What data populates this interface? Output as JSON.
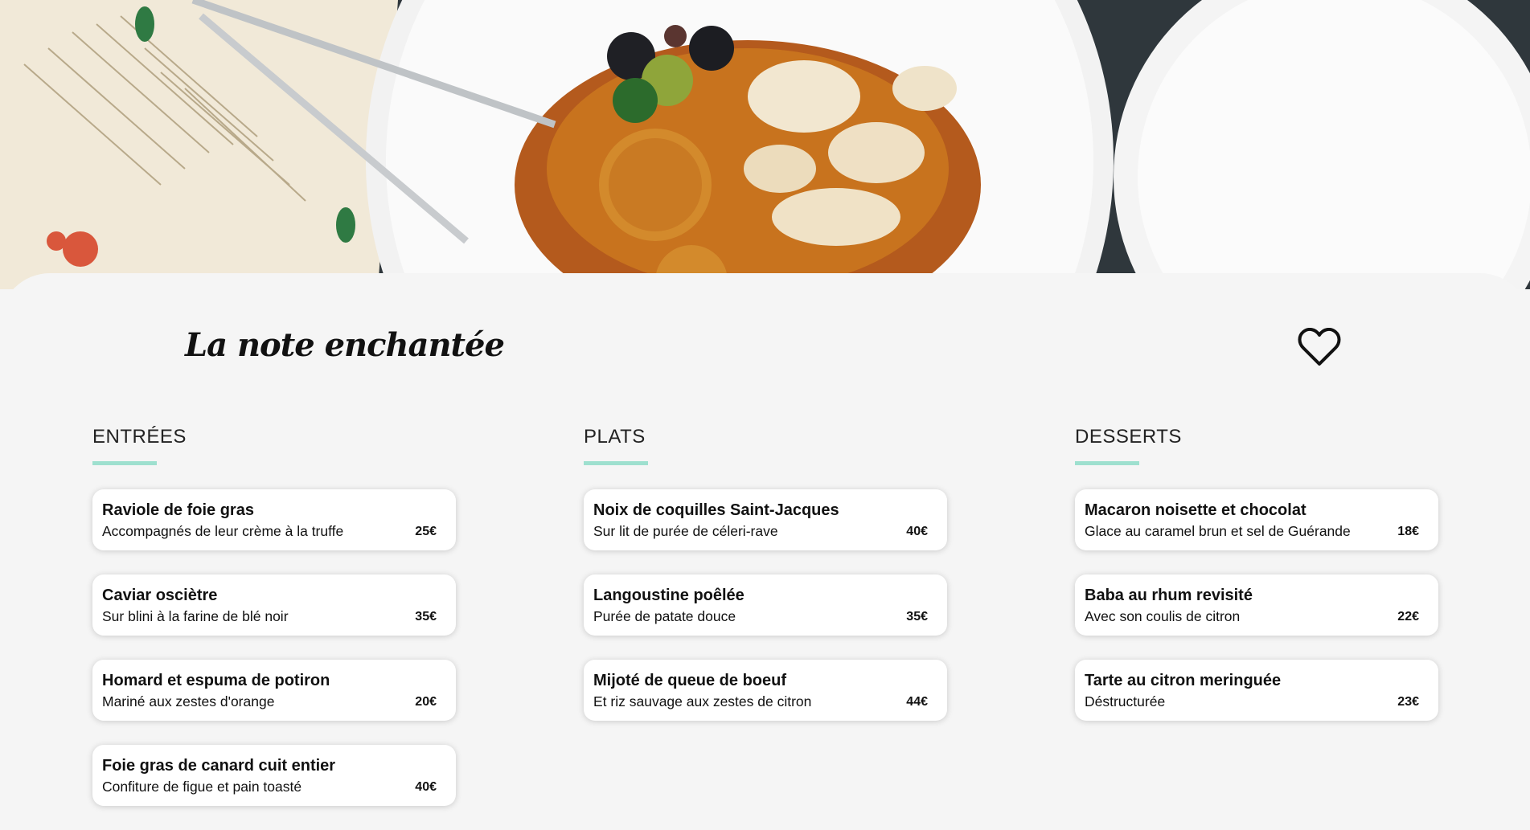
{
  "restaurant": {
    "name": "La note enchantée"
  },
  "hero": {
    "image": "food-photo"
  },
  "icons": {
    "favorite": "heart-icon"
  },
  "colors": {
    "accent": "#9ee0cf",
    "background": "#f5f5f5"
  },
  "menu": {
    "entrees": {
      "title": "ENTRÉES",
      "items": [
        {
          "name": "Raviole de foie gras",
          "description": "Accompagnés de leur crème à la truffe",
          "price": "25€"
        },
        {
          "name": "Caviar osciètre",
          "description": "Sur blini à la farine de blé noir",
          "price": "35€"
        },
        {
          "name": "Homard et espuma de potiron",
          "description": "Mariné aux zestes d'orange",
          "price": "20€"
        },
        {
          "name": "Foie gras de canard cuit entier",
          "description": "Confiture de figue et pain toasté",
          "price": "40€"
        }
      ]
    },
    "plats": {
      "title": "PLATS",
      "items": [
        {
          "name": "Noix de coquilles Saint-Jacques",
          "description": "Sur lit de purée de céleri-rave",
          "price": "40€"
        },
        {
          "name": "Langoustine poêlée",
          "description": "Purée de patate douce",
          "price": "35€"
        },
        {
          "name": "Mijoté de queue de boeuf",
          "description": "Et riz sauvage aux zestes de citron",
          "price": "44€"
        }
      ]
    },
    "desserts": {
      "title": "DESSERTS",
      "items": [
        {
          "name": "Macaron noisette et chocolat",
          "description": "Glace au caramel brun et sel de Guérande",
          "price": "18€"
        },
        {
          "name": "Baba au rhum revisité",
          "description": "Avec son coulis de citron",
          "price": "22€"
        },
        {
          "name": "Tarte au citron meringuée",
          "description": "Déstructurée",
          "price": "23€"
        }
      ]
    }
  }
}
